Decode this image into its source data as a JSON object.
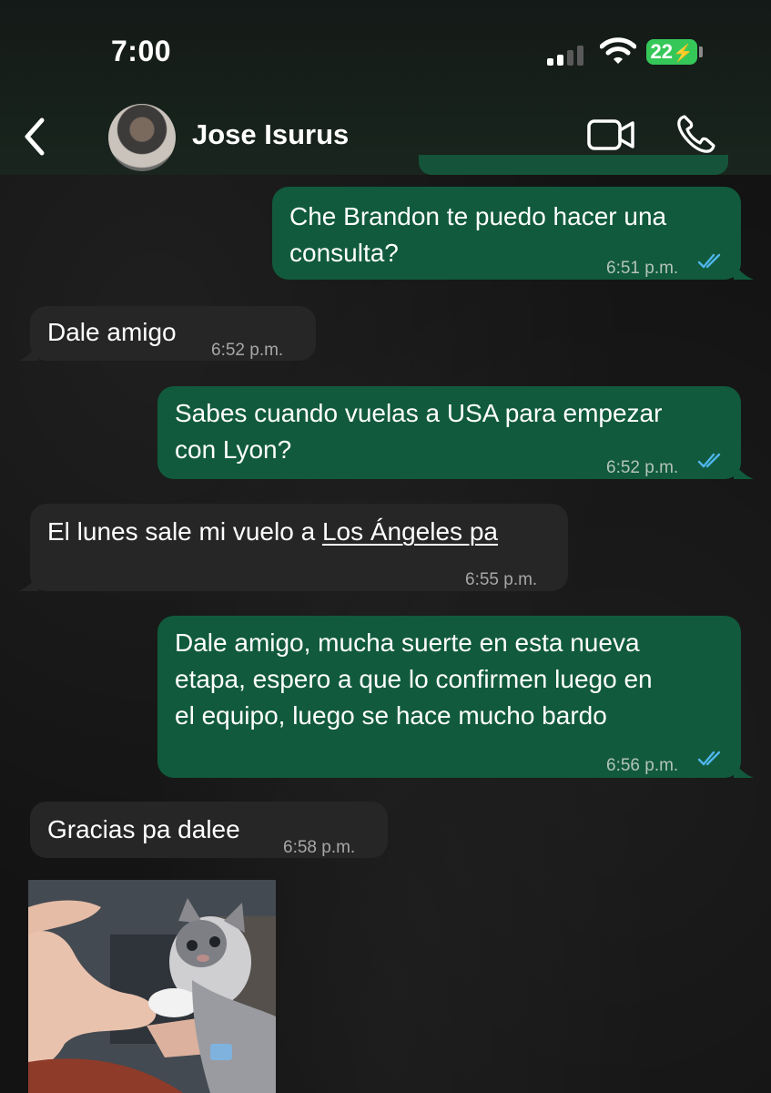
{
  "status_bar": {
    "time": "7:00",
    "battery": "22"
  },
  "header": {
    "contact_name": "Jose Isurus"
  },
  "messages": [
    {
      "direction": "out",
      "lines": [
        "Che Brandon te puedo hacer una",
        "consulta?"
      ],
      "time": "6:51 p.m."
    },
    {
      "direction": "in",
      "lines": [
        "Dale amigo"
      ],
      "time": "6:52 p.m."
    },
    {
      "direction": "out",
      "lines": [
        "Sabes cuando vuelas a USA para empezar",
        "con Lyon?"
      ],
      "time": "6:52 p.m."
    },
    {
      "direction": "in",
      "lines_prefix": "El lunes sale mi vuelo a ",
      "link": "Los Ángeles pa",
      "time": "6:55 p.m."
    },
    {
      "direction": "out",
      "lines": [
        "Dale amigo, mucha suerte en esta nueva",
        "etapa, espero a que lo confirmen luego en",
        "el equipo, luego se hace mucho bardo"
      ],
      "time": "6:56 p.m."
    },
    {
      "direction": "in",
      "lines": [
        "Gracias pa dalee"
      ],
      "time": "6:58 p.m."
    }
  ],
  "colors": {
    "outgoing_bubble": "#115a3d",
    "incoming_bubble": "#262626",
    "read_ticks": "#4fb6ec",
    "battery": "#36c759"
  },
  "icons": [
    "signal-icon",
    "wifi-icon",
    "back-icon",
    "video-call-icon",
    "phone-icon",
    "double-check-icon"
  ]
}
